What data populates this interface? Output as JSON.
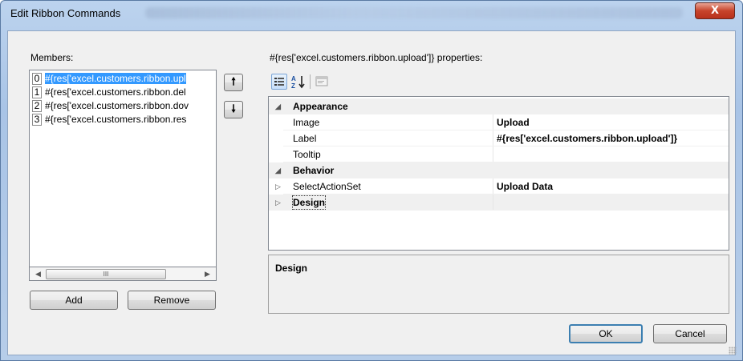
{
  "window": {
    "title": "Edit Ribbon Commands",
    "close_glyph": "X"
  },
  "members": {
    "label": "Members:",
    "items": [
      {
        "index": "0",
        "text": "#{res['excel.customers.ribbon.upl",
        "selected": true
      },
      {
        "index": "1",
        "text": "#{res['excel.customers.ribbon.del",
        "selected": false
      },
      {
        "index": "2",
        "text": "#{res['excel.customers.ribbon.dov",
        "selected": false
      },
      {
        "index": "3",
        "text": "#{res['excel.customers.ribbon.res",
        "selected": false
      }
    ],
    "scroll_thumb_glyph": "III",
    "up_icon": "arrow-up-icon",
    "down_icon": "arrow-down-icon"
  },
  "buttons": {
    "add": "Add",
    "remove": "Remove",
    "ok": "OK",
    "cancel": "Cancel"
  },
  "properties": {
    "heading": "#{res['excel.customers.ribbon.upload']} properties:",
    "toolbar": [
      "categorized-icon",
      "alphabetical-icon",
      "property-pages-icon"
    ],
    "rows": [
      {
        "type": "category",
        "name": "Appearance",
        "expander": "◢"
      },
      {
        "type": "prop",
        "name": "Image",
        "value": "Upload"
      },
      {
        "type": "prop",
        "name": "Label",
        "value": "#{res['excel.customers.ribbon.upload']}"
      },
      {
        "type": "prop",
        "name": "Tooltip",
        "value": ""
      },
      {
        "type": "category",
        "name": "Behavior",
        "expander": "◢"
      },
      {
        "type": "prop",
        "name": "SelectActionSet",
        "value": "Upload Data",
        "expander": "▷"
      },
      {
        "type": "prop-bold",
        "name": "Design",
        "value": "",
        "expander": "▷"
      }
    ],
    "description_title": "Design"
  },
  "colors": {
    "selection": "#3399ff",
    "close_button": "#c7442b"
  }
}
